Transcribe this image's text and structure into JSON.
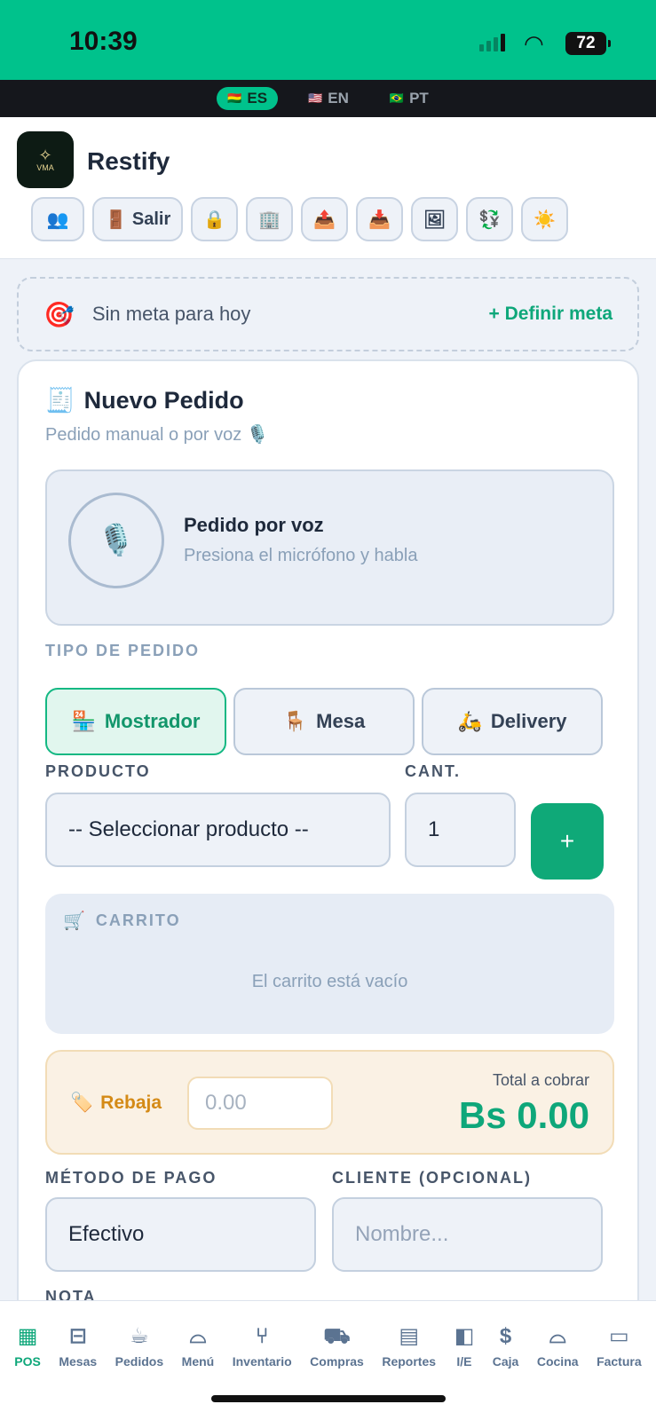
{
  "status": {
    "time": "10:39",
    "battery": "72"
  },
  "languages": [
    {
      "flag": "🇧🇴",
      "code": "ES"
    },
    {
      "flag": "🇺🇸",
      "code": "EN"
    },
    {
      "flag": "🇧🇷",
      "code": "PT"
    }
  ],
  "header": {
    "app_name": "Restify",
    "logo_text": "VMA",
    "exit_label": "Salir"
  },
  "goal": {
    "text": "Sin meta para hoy",
    "action": "+ Definir meta"
  },
  "order": {
    "title": "Nuevo Pedido",
    "subtitle": "Pedido manual o por voz",
    "voice_title": "Pedido por voz",
    "voice_sub": "Presiona el micrófono y habla",
    "type_label": "TIPO DE PEDIDO",
    "types": [
      "Mostrador",
      "Mesa",
      "Delivery"
    ],
    "product_label": "PRODUCTO",
    "qty_label": "CANT.",
    "product_value": "-- Seleccionar producto --",
    "qty_value": "1",
    "add_label": "+",
    "cart_label": "CARRITO",
    "cart_empty": "El carrito está vacío",
    "discount_label": "Rebaja",
    "discount_placeholder": "0.00",
    "total_label": "Total a cobrar",
    "total_value": "Bs 0.00",
    "payment_label": "MÉTODO DE PAGO",
    "payment_value": "Efectivo",
    "client_label": "CLIENTE (OPCIONAL)",
    "client_placeholder": "Nombre...",
    "note_label": "NOTA"
  },
  "nav": [
    "POS",
    "Mesas",
    "Pedidos",
    "Menú",
    "Inventario",
    "Compras",
    "Reportes",
    "I/E",
    "Caja",
    "Cocina",
    "Factura"
  ],
  "colors": {
    "accent": "#00c28c",
    "primary_button": "#0fa978",
    "total": "#0ea77a",
    "discount": "#d48a16"
  }
}
